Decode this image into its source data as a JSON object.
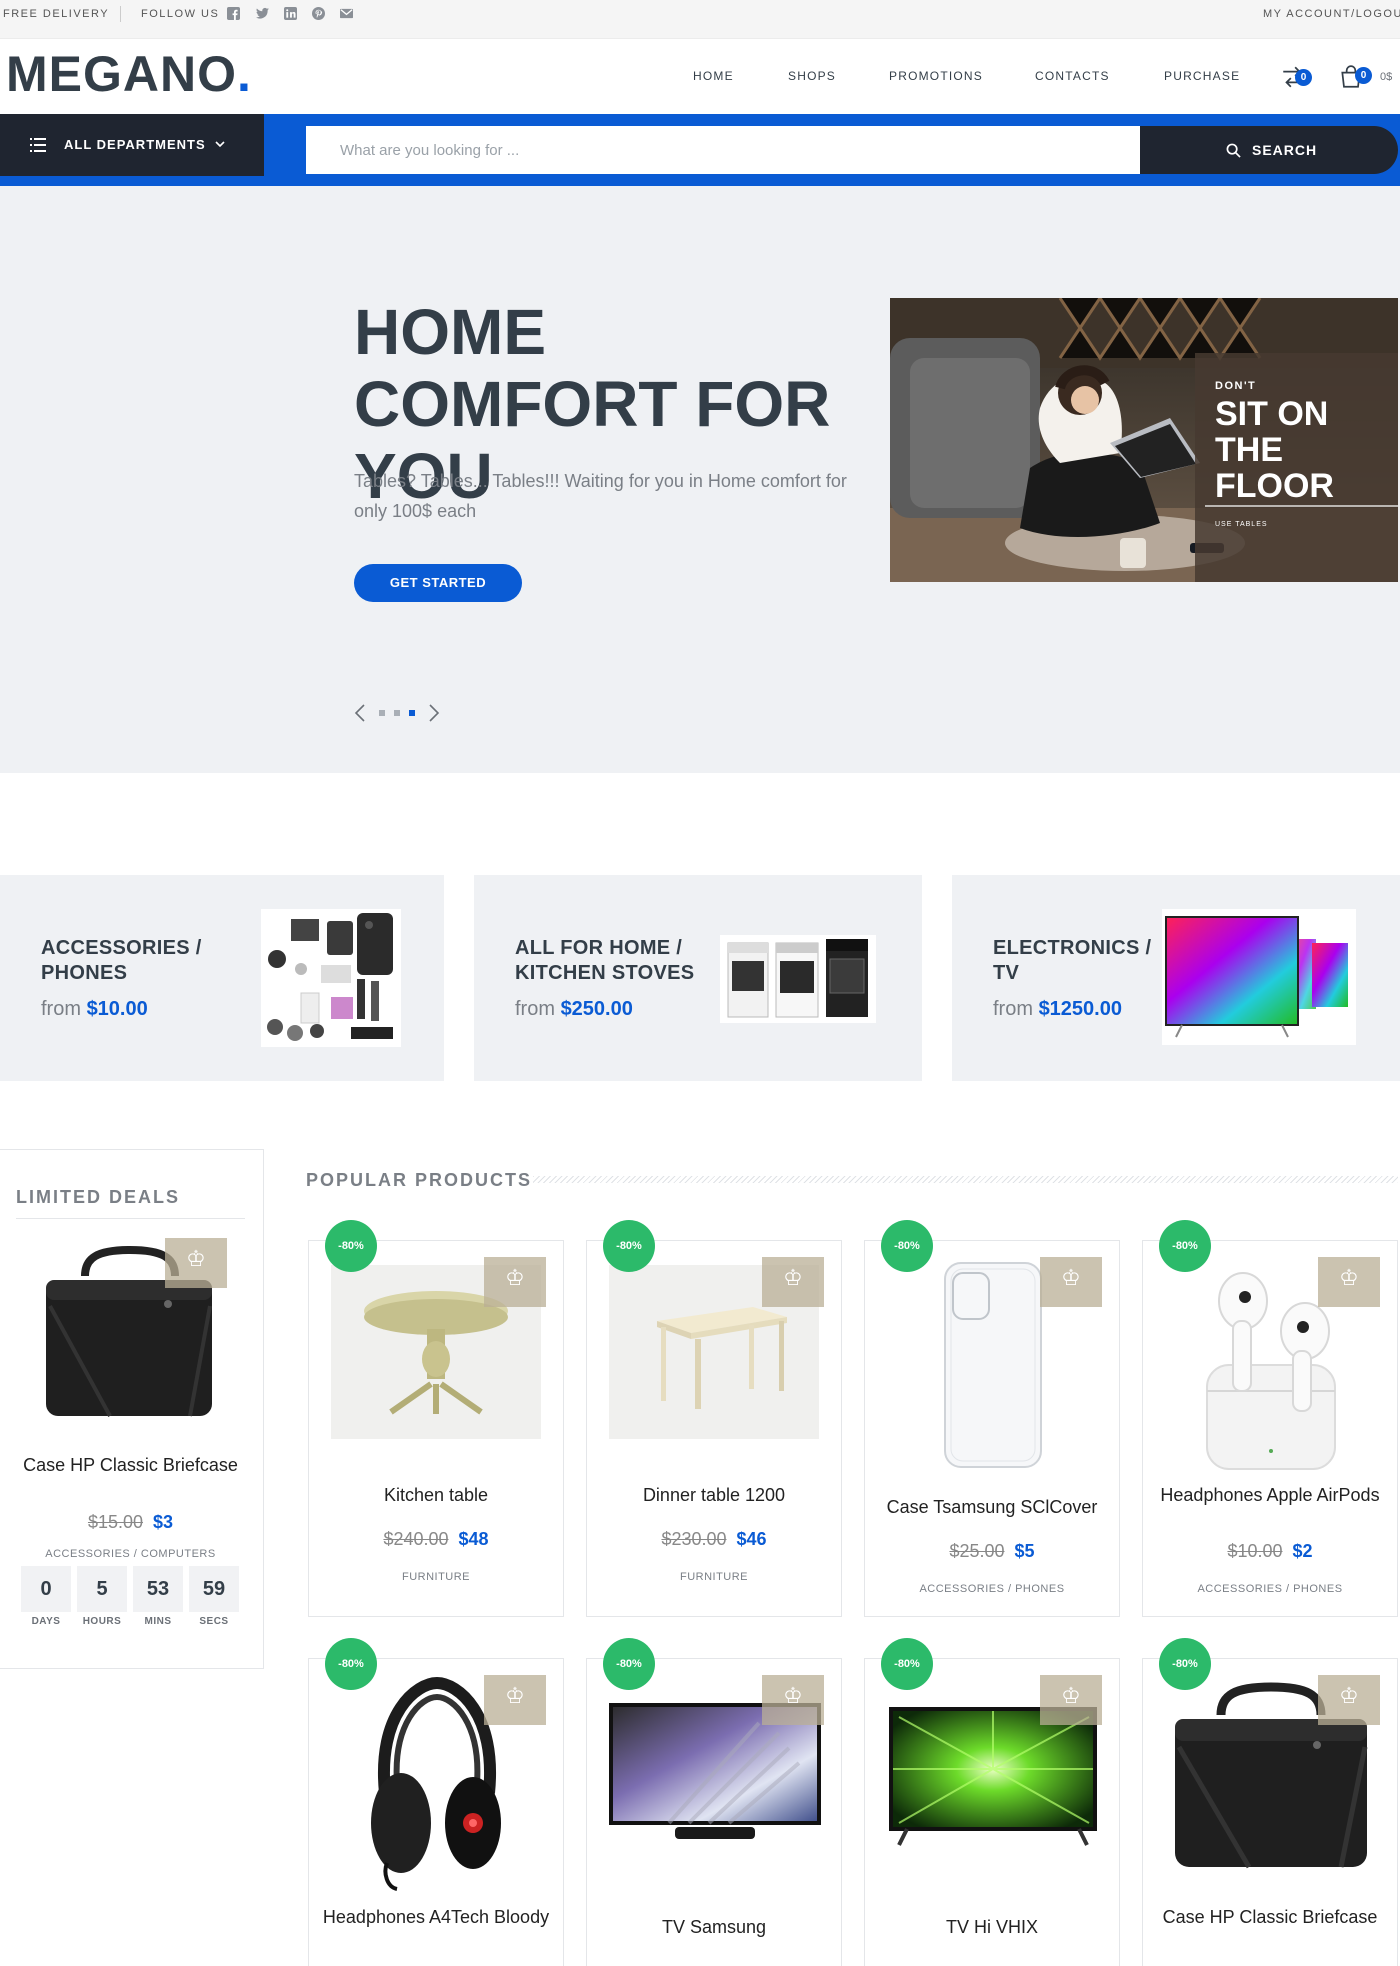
{
  "topbar": {
    "free_delivery": "FREE DELIVERY",
    "follow_us": "FOLLOW US",
    "account": "MY ACCOUNT/LOGOUT",
    "social_icons": [
      "facebook-icon",
      "twitter-icon",
      "linkedin-icon",
      "pinterest-icon",
      "email-icon"
    ]
  },
  "header": {
    "logo": "MEGANO",
    "logo_dot": ".",
    "nav": [
      "HOME",
      "SHOPS",
      "PROMOTIONS",
      "CONTACTS",
      "PURCHASE"
    ],
    "compare_count": "0",
    "cart_count": "0",
    "cart_total": "0$"
  },
  "search": {
    "departments_label": "ALL DEPARTMENTS",
    "placeholder": "What are you looking for ...",
    "value": "",
    "button_label": "SEARCH"
  },
  "hero": {
    "title": "HOME COMFORT FOR YOU",
    "subtitle": "Tables? Tables... Tables!!! Waiting for you in Home comfort for only 100$ each",
    "cta": "GET STARTED",
    "image_caption": {
      "small": "DON'T",
      "big": [
        "SIT ON",
        "THE",
        "FLOOR"
      ],
      "tag": "USE TABLES"
    },
    "slides_count": 3,
    "active_slide": 3
  },
  "categories": [
    {
      "title": "ACCESSORIES / PHONES",
      "from": "from",
      "price": "$10.00"
    },
    {
      "title": "ALL FOR HOME / KITCHEN STOVES",
      "from": "from",
      "price": "$250.00"
    },
    {
      "title": "ELECTRONICS / TV",
      "from": "from",
      "price": "$1250.00"
    }
  ],
  "deals": {
    "title": "LIMITED DEALS",
    "product": {
      "name": "Case HP Classic Briefcase",
      "old_price": "$15.00",
      "price": "$3",
      "category": "ACCESSORIES / COMPUTERS"
    },
    "countdown": [
      {
        "value": "0",
        "label": "DAYS"
      },
      {
        "value": "5",
        "label": "HOURS"
      },
      {
        "value": "53",
        "label": "MINS"
      },
      {
        "value": "59",
        "label": "SECS"
      }
    ]
  },
  "popular": {
    "title": "POPULAR PRODUCTS",
    "products": [
      {
        "name": "Kitchen table",
        "old_price": "$240.00",
        "price": "$48",
        "category": "FURNITURE",
        "discount": "-80%"
      },
      {
        "name": "Dinner table 1200",
        "old_price": "$230.00",
        "price": "$46",
        "category": "FURNITURE",
        "discount": "-80%"
      },
      {
        "name": "Case Tsamsung SClCover",
        "old_price": "$25.00",
        "price": "$5",
        "category": "ACCESSORIES / PHONES",
        "discount": "-80%"
      },
      {
        "name": "Headphones Apple AirPods",
        "old_price": "$10.00",
        "price": "$2",
        "category": "ACCESSORIES / PHONES",
        "discount": "-80%"
      },
      {
        "name": "Headphones A4Tech Bloody",
        "discount": "-80%"
      },
      {
        "name": "TV Samsung",
        "discount": "-80%"
      },
      {
        "name": "TV Hi VHIX",
        "discount": "-80%"
      },
      {
        "name": "Case HP Classic Briefcase",
        "discount": "-80%"
      }
    ]
  },
  "colors": {
    "accent": "#0a5bd4",
    "dark": "#1f2530",
    "discount": "#2cba6a",
    "text": "#333e48"
  }
}
